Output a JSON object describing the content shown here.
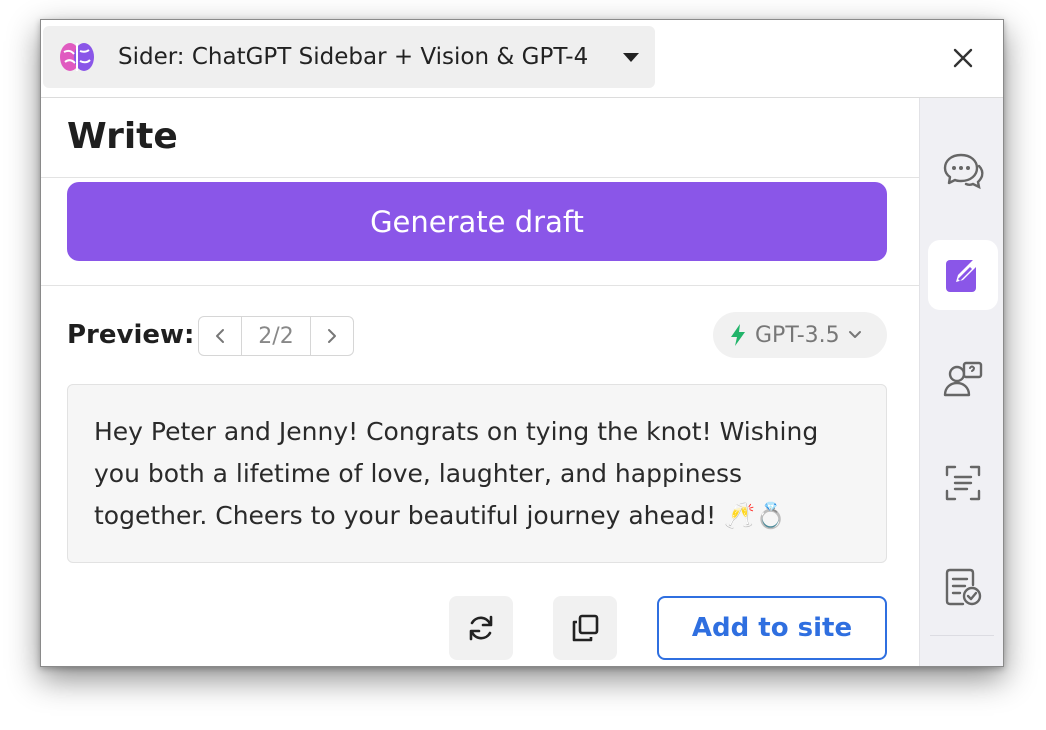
{
  "titlebar": {
    "extension_name": "Sider: ChatGPT Sidebar + Vision & GPT-4",
    "icons": {
      "logo": "brain-icon",
      "dropdown": "caret-down-icon",
      "close": "close-icon"
    }
  },
  "main": {
    "page_title": "Write",
    "generate_label": "Generate draft",
    "preview_label": "Preview:",
    "pager": {
      "page": "2/2"
    },
    "model": "GPT-3.5",
    "preview_text": "Hey Peter and Jenny! Congrats on tying the knot! Wishing you both a lifetime of love, laughter, and happiness together. Cheers to your beautiful journey ahead! 🥂💍",
    "add_to_site_label": "Add to site"
  },
  "sidebar": {
    "items": [
      {
        "icon": "chat-icon",
        "active": false
      },
      {
        "icon": "write-icon",
        "active": true
      },
      {
        "icon": "ask-user-icon",
        "active": false
      },
      {
        "icon": "scan-text-icon",
        "active": false
      },
      {
        "icon": "checklist-icon",
        "active": false
      }
    ]
  },
  "colors": {
    "primary": "#8a56e8",
    "link_blue": "#2f6fe0",
    "bolt_green": "#22b46a"
  }
}
